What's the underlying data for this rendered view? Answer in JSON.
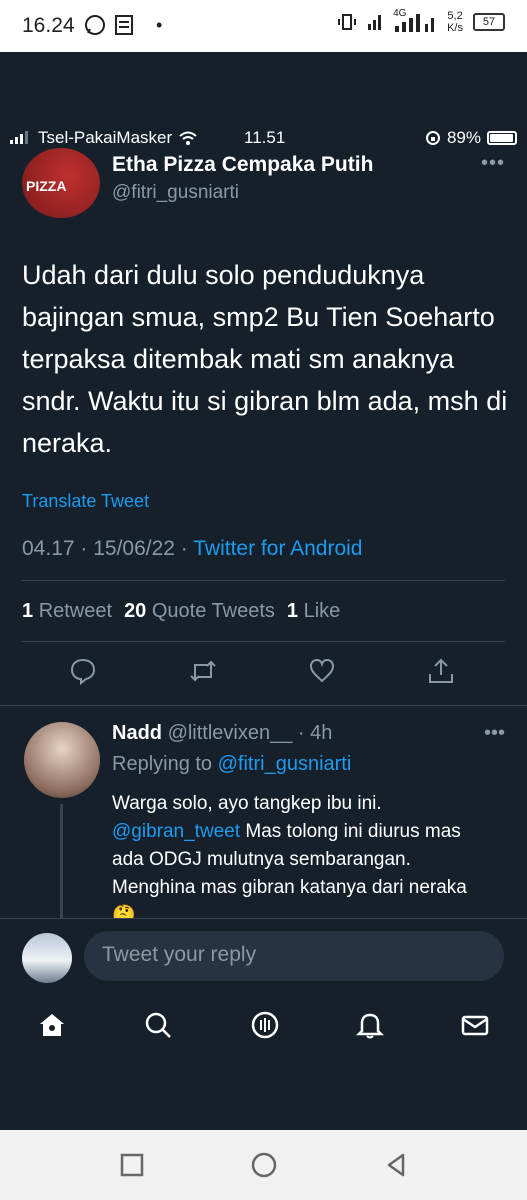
{
  "os_status": {
    "time": "16.24",
    "network": "4G",
    "speed": "5,2\nK/s",
    "speed_top": "5,2",
    "speed_bottom": "K/s",
    "battery": "57"
  },
  "ios_status": {
    "carrier": "Tsel-PakaiMasker",
    "time": "11.51",
    "battery": "89%"
  },
  "tweet": {
    "author_name": "Etha Pizza Cempaka Putih",
    "author_handle": "@fitri_gusniarti",
    "avatar_text": "PIZZA",
    "text": "Udah dari dulu solo penduduknya bajingan smua, smp2 Bu Tien Soeharto terpaksa ditembak mati sm anaknya sndr. Waktu itu si gibran blm ada, msh di neraka.",
    "translate": "Translate Tweet",
    "time": "04.17 · 15/06/22 · ",
    "source": "Twitter for Android",
    "stats": {
      "retweets_count": "1",
      "retweets_label": "Retweet",
      "quotes_count": "20",
      "quotes_label": "Quote Tweets",
      "likes_count": "1",
      "likes_label": "Like"
    }
  },
  "reply": {
    "name": "Nadd",
    "handle_time": "@littlevixen__ · 4h",
    "replying_label": "Replying to ",
    "replying_to": "@fitri_gusniarti",
    "text_line1": "Warga solo, ayo tangkep ibu ini.",
    "mention": "@gibran_tweet",
    "text_rest": " Mas tolong ini diurus mas ada ODGJ mulutnya sembarangan. Menghina mas gibran katanya dari neraka 🤔"
  },
  "composer": {
    "placeholder": "Tweet your reply"
  },
  "icons": {
    "reply": "reply-icon",
    "retweet": "retweet-icon",
    "like": "heart-icon",
    "share": "share-icon",
    "home": "home-icon",
    "search": "search-icon",
    "spaces": "spaces-icon",
    "notifications": "bell-icon",
    "messages": "mail-icon"
  },
  "colors": {
    "background": "#15202b",
    "accent": "#1d9bf0",
    "muted": "#8b98a5",
    "divider": "#38444d"
  }
}
